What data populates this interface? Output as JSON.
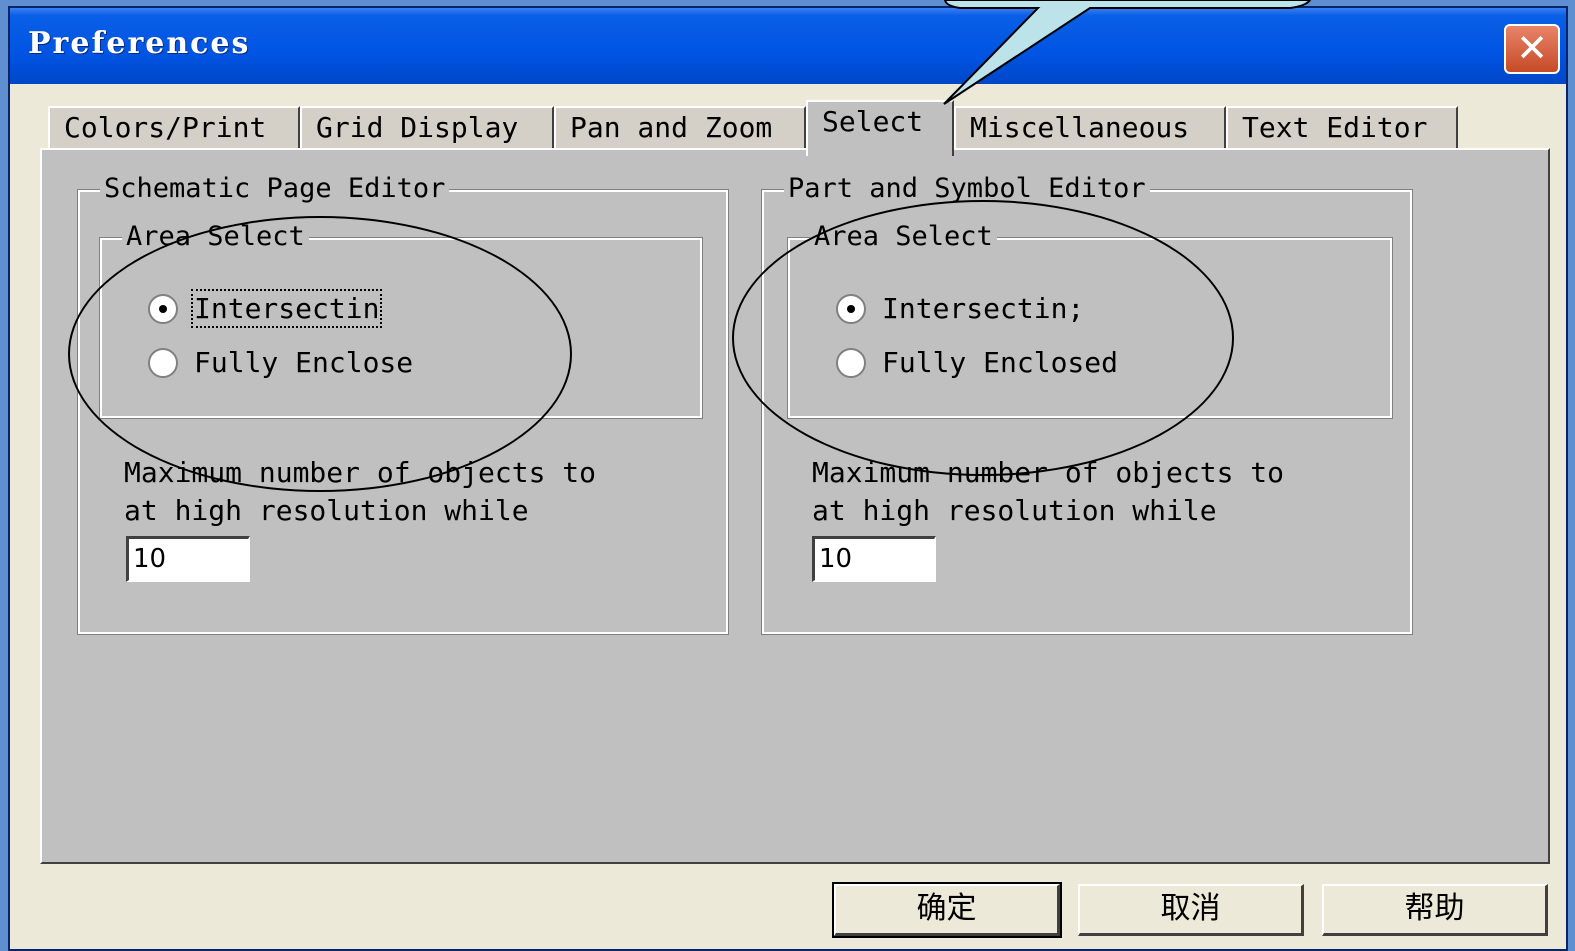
{
  "window": {
    "title": "Preferences",
    "close_label": "✕"
  },
  "tabs": [
    {
      "label": "Colors/Print",
      "active": false
    },
    {
      "label": "Grid Display",
      "active": false
    },
    {
      "label": "Pan and Zoom",
      "active": false
    },
    {
      "label": "Select",
      "active": true
    },
    {
      "label": "Miscellaneous",
      "active": false
    },
    {
      "label": "Text Editor",
      "active": false
    }
  ],
  "schematic": {
    "group_label": "Schematic Page Editor",
    "area_select_label": "Area Select",
    "option_intersecting": "Intersectin",
    "option_fully_enclosed": "Fully Enclose",
    "selected": "intersecting",
    "max_label_line1": "Maximum number of objects to",
    "max_label_line2": "at high resolution while",
    "max_value": "10"
  },
  "part_symbol": {
    "group_label": "Part and Symbol Editor",
    "area_select_label": "Area Select",
    "option_intersecting": "Intersectin;",
    "option_fully_enclosed": "Fully Enclosed",
    "selected": "intersecting",
    "max_label_line1": "Maximum number of objects to",
    "max_label_line2": "at high resolution while",
    "max_value": "10"
  },
  "buttons": {
    "ok": "确定",
    "cancel": "取消",
    "help": "帮助"
  },
  "colors": {
    "callout_fill": "#bde3ea",
    "titlebar": "#0054e3",
    "panel": "#c0c0c0"
  }
}
